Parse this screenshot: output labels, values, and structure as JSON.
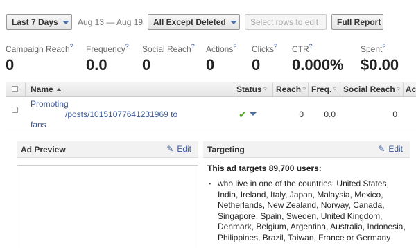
{
  "toolbar": {
    "date_range_label": "Last 7 Days",
    "date_range_text": "Aug 13 — Aug 19",
    "filter_label": "All Except Deleted",
    "select_rows_label": "Select rows to edit",
    "full_report_label": "Full Report"
  },
  "stats": [
    {
      "label": "Campaign Reach",
      "value": "0"
    },
    {
      "label": "Frequency",
      "value": "0.0"
    },
    {
      "label": "Social Reach",
      "value": "0"
    },
    {
      "label": "Actions",
      "value": "0"
    },
    {
      "label": "Clicks",
      "value": "0"
    },
    {
      "label": "CTR",
      "value": "0.000%"
    },
    {
      "label": "Spent",
      "value": "$0.00"
    }
  ],
  "help_mark": "?",
  "table": {
    "columns": {
      "name": "Name",
      "status": "Status",
      "reach": "Reach",
      "freq": "Freq.",
      "social_reach": "Social Reach",
      "actions": "Act"
    },
    "row": {
      "name_line1": "Promoting",
      "name_line2": "/posts/10151077641231969 to",
      "name_line3": "fans",
      "reach": "0",
      "freq": "0.0",
      "social_reach": "0"
    }
  },
  "ad_preview": {
    "title": "Ad Preview",
    "edit_label": "Edit"
  },
  "targeting": {
    "title": "Targeting",
    "edit_label": "Edit",
    "headline": "This ad targets 89,700 users:",
    "countries": "who live in one of the countries: United States, India, Ireland, Italy, Japan, Malaysia, Mexico, Netherlands, New Zealand, Norway, Canada, Singapore, Spain, Sweden, United Kingdom, Denmark, Belgium, Argentina, Australia, Indonesia, Philippines, Brazil, Taiwan, France or Germany"
  },
  "colors": {
    "link": "#3b5998",
    "status_ok": "#55aa22"
  }
}
